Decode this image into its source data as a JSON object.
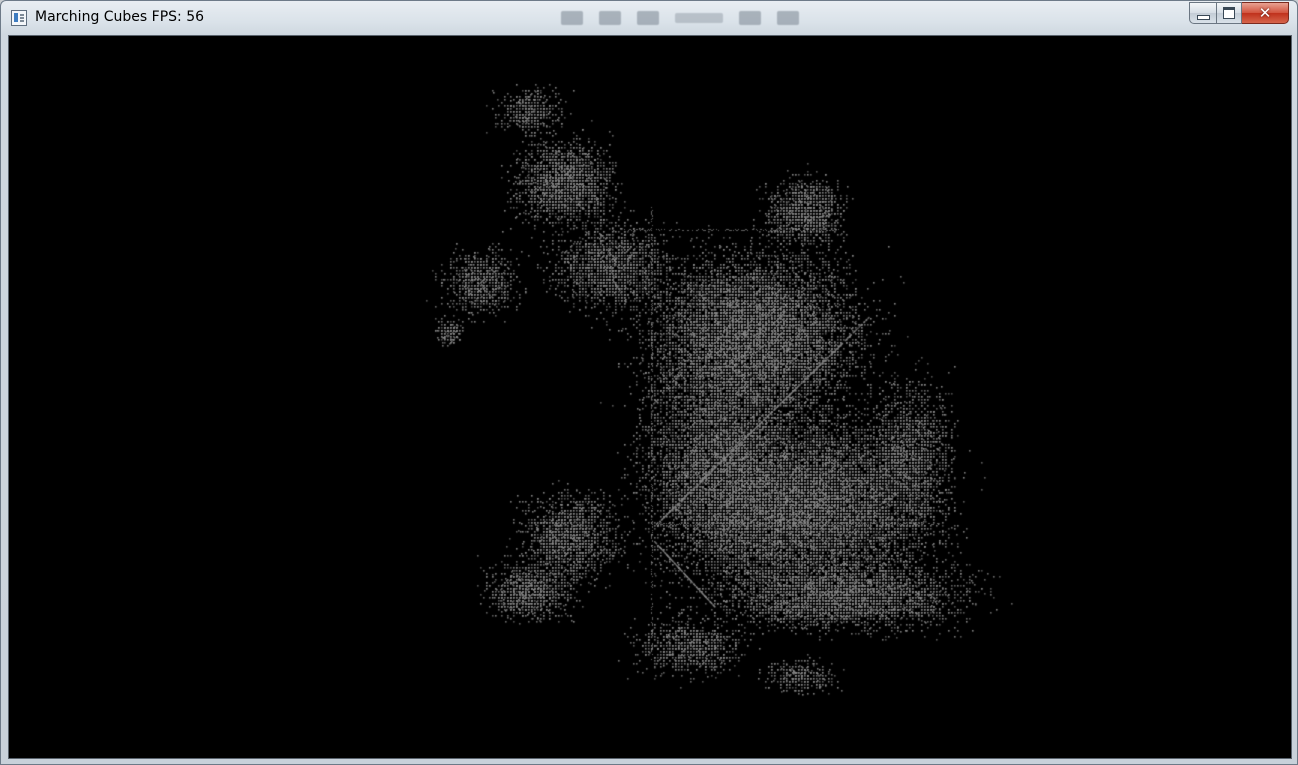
{
  "window": {
    "title": "Marching Cubes  FPS: 56",
    "app_icon": "window-app-icon",
    "controls": {
      "minimize_icon": "minimize-icon",
      "maximize_icon": "maximize-icon",
      "close_icon": "close-icon",
      "close_glyph": "✕"
    }
  },
  "viewport": {
    "background": "#000000",
    "point_color": "#8a8a8a",
    "content": "marching-cubes-point-cloud"
  },
  "colors": {
    "close_button": "#c7402a",
    "title_text": "#000000"
  }
}
